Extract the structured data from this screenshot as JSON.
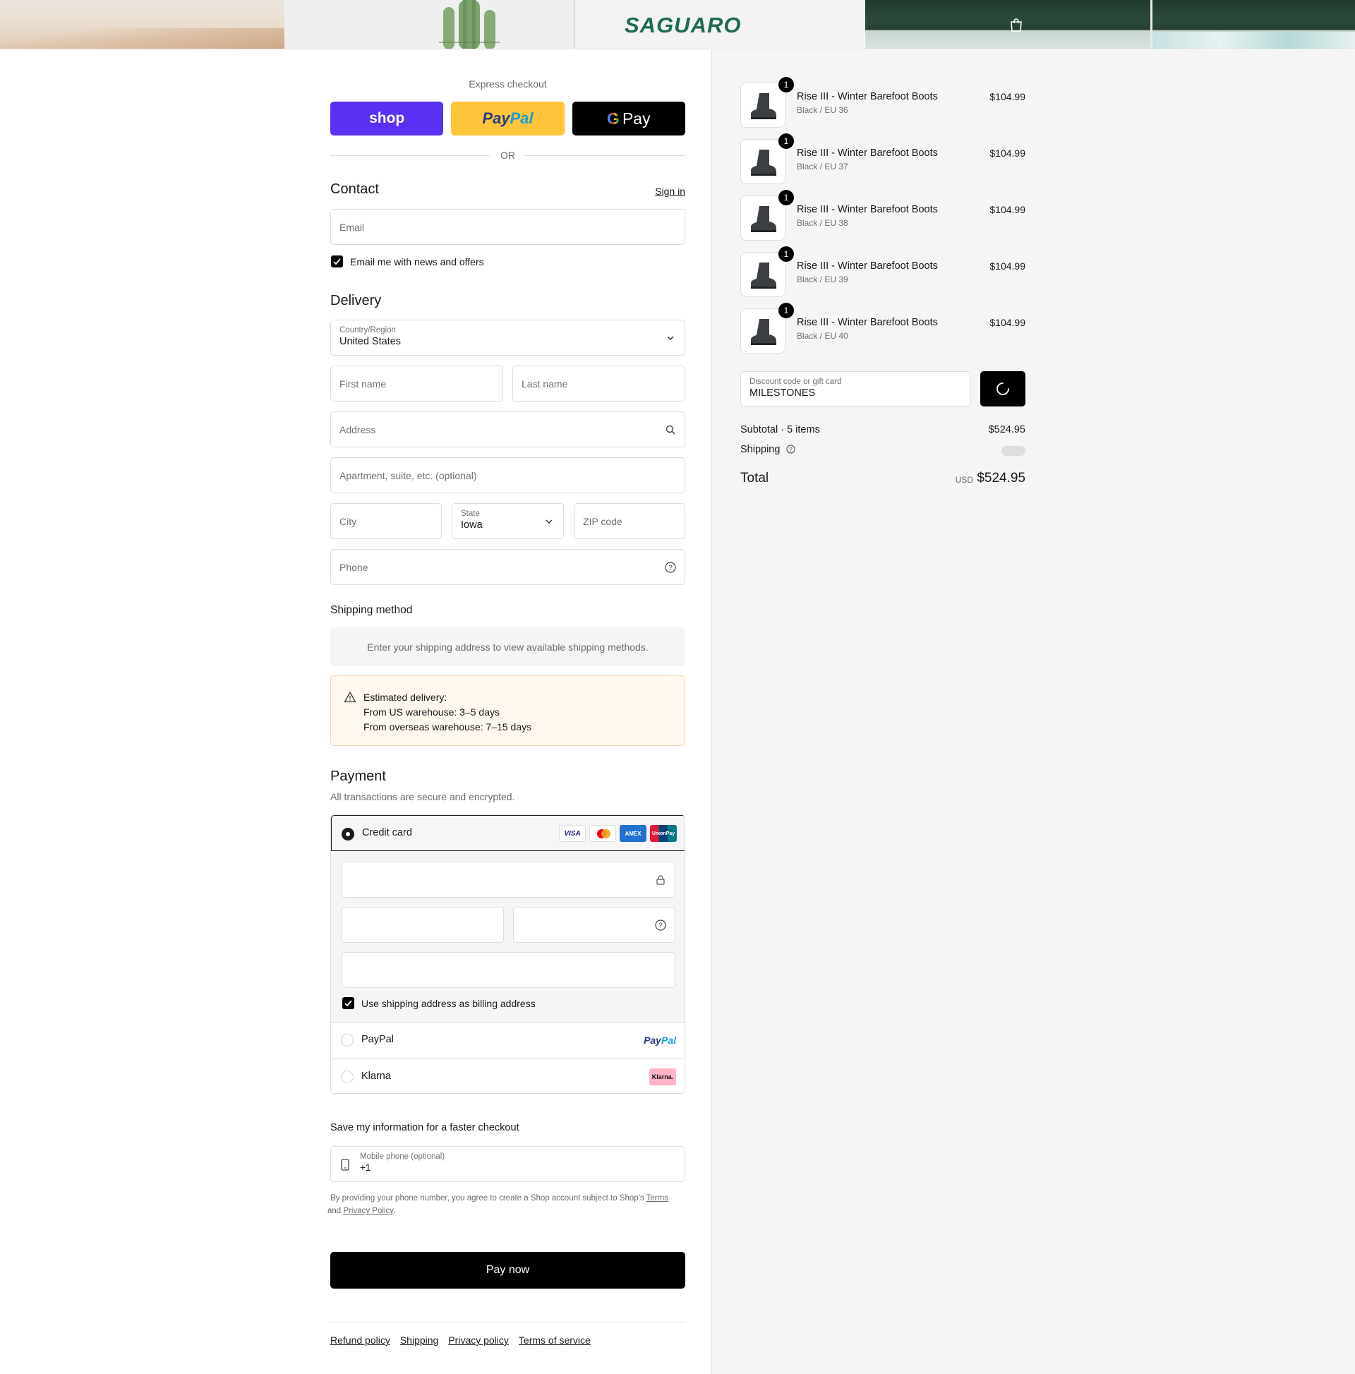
{
  "header": {
    "logo": "SAGUARO"
  },
  "express": {
    "title": "Express checkout",
    "shop_label": "shop",
    "paypal_label_1": "Pay",
    "paypal_label_2": "Pal",
    "gpay_g": "G",
    "gpay_label": "Pay",
    "or_label": "OR"
  },
  "contact": {
    "title": "Contact",
    "sign_in": "Sign in",
    "email_placeholder": "Email",
    "news_label": "Email me with news and offers"
  },
  "delivery": {
    "title": "Delivery",
    "country_label": "Country/Region",
    "country_value": "United States",
    "first_name": "First name",
    "last_name": "Last name",
    "address": "Address",
    "apartment": "Apartment, suite, etc. (optional)",
    "city": "City",
    "state_label": "State",
    "state_value": "Iowa",
    "zip": "ZIP code",
    "phone": "Phone"
  },
  "shipping_method": {
    "title": "Shipping method",
    "info": "Enter your shipping address to view available shipping methods."
  },
  "notice": {
    "line1": "Estimated delivery:",
    "line2": "From US warehouse: 3–5 days",
    "line3": "From overseas warehouse: 7–15 days"
  },
  "payment": {
    "title": "Payment",
    "subtitle": "All transactions are secure and encrypted.",
    "credit_card": "Credit card",
    "card_brands": [
      "VISA",
      "Mastercard",
      "AMEX",
      "UnionPay"
    ],
    "billing_label": "Use shipping address as billing address",
    "paypal": "PayPal",
    "paypal_logo_1": "Pay",
    "paypal_logo_2": "Pal",
    "klarna": "Klarna",
    "klarna_logo": "Klarna."
  },
  "save_info": {
    "title": "Save my information for a faster checkout",
    "phone_label": "Mobile phone (optional)",
    "phone_value": "+1",
    "fine_1": "By providing your phone number, you agree to create a Shop account subject to Shop's ",
    "terms": "Terms",
    "fine_2": " and ",
    "privacy": "Privacy Policy",
    "fine_3": "."
  },
  "pay_now": "Pay now",
  "footer": [
    "Refund policy",
    "Shipping",
    "Privacy policy",
    "Terms of service"
  ],
  "summary": {
    "items": [
      {
        "name": "Rise III - Winter Barefoot Boots",
        "variant": "Black / EU 36",
        "price": "$104.99",
        "qty": "1"
      },
      {
        "name": "Rise III - Winter Barefoot Boots",
        "variant": "Black / EU 37",
        "price": "$104.99",
        "qty": "1"
      },
      {
        "name": "Rise III - Winter Barefoot Boots",
        "variant": "Black / EU 38",
        "price": "$104.99",
        "qty": "1"
      },
      {
        "name": "Rise III - Winter Barefoot Boots",
        "variant": "Black / EU 39",
        "price": "$104.99",
        "qty": "1"
      },
      {
        "name": "Rise III - Winter Barefoot Boots",
        "variant": "Black / EU 40",
        "price": "$104.99",
        "qty": "1"
      }
    ],
    "discount_label": "Discount code or gift card",
    "discount_value": "MILESTONES",
    "subtotal_label": "Subtotal · 5 items",
    "subtotal_value": "$524.95",
    "shipping_label": "Shipping",
    "total_label": "Total",
    "currency": "USD",
    "total_value": "$524.95"
  },
  "colors": {
    "shop": "#5a31f4",
    "paypal": "#ffc439",
    "accent": "#1f6b52",
    "notice_bg": "#fff8ef"
  }
}
